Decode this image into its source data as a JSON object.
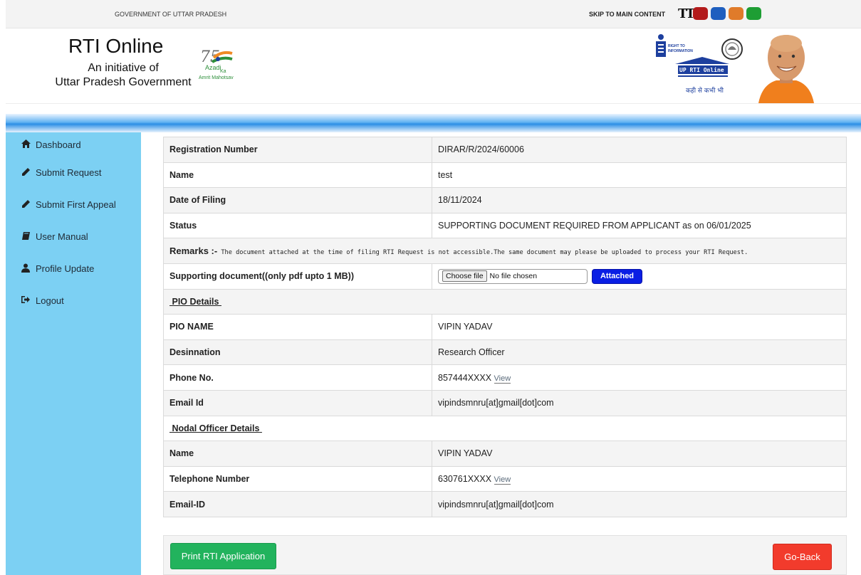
{
  "topbar": {
    "gov_label": "GOVERNMENT OF UTTAR PRADESH",
    "skip_link": "SKIP TO MAIN CONTENT",
    "text_size_icon": "TT",
    "theme_colors": [
      "#b22222",
      "#1f5fbf",
      "#e07b2a",
      "#1e9e34"
    ]
  },
  "header": {
    "title": "RTI Online",
    "subtitle_line1": "An initiative of",
    "subtitle_line2": "Uttar Pradesh Government",
    "azadi_logo": {
      "number": "75",
      "line1": "Azadi",
      "line2": "Ka",
      "line3": "Amrit Mahotsav"
    },
    "rti_logo": {
      "line1": "RIGHT TO",
      "line2": "INFORMATION",
      "badge": "UP RTI Online",
      "tagline": "कही से कभी भी"
    }
  },
  "sidebar": {
    "items": [
      {
        "label": "Dashboard",
        "icon": "home-icon"
      },
      {
        "label": "Submit Request",
        "icon": "pencil-icon"
      },
      {
        "label": "Submit First Appeal",
        "icon": "pencil-icon"
      },
      {
        "label": "User Manual",
        "icon": "book-icon"
      },
      {
        "label": "Profile Update",
        "icon": "user-icon"
      },
      {
        "label": "Logout",
        "icon": "sign-out-icon"
      }
    ]
  },
  "details": {
    "registration_label": "Registration Number",
    "registration_value": "DIRAR/R/2024/60006",
    "name_label": "Name",
    "name_value": "test",
    "date_label": "Date of Filing",
    "date_value": "18/11/2024",
    "status_label": "Status",
    "status_value": "SUPPORTING DOCUMENT REQUIRED FROM APPLICANT as on 06/01/2025",
    "remarks_label": "Remarks :-",
    "remarks_text": " The document attached at the time of filing RTI Request is not accessible.The same document may please be uploaded to process your RTI Request.",
    "supporting_label": "Supporting document((only pdf upto 1 MB))",
    "file_button": "Choose file",
    "file_status": "No file chosen",
    "attach_button": "Attached"
  },
  "pio": {
    "section_title": "PIO Details",
    "name_label": "PIO NAME",
    "name_value": "VIPIN YADAV",
    "designation_label": "Desinnation",
    "designation_value": "Research Officer",
    "phone_label": "Phone No.",
    "phone_value": "857444XXXX",
    "phone_view": "View",
    "email_label": "Email Id",
    "email_value": "vipindsmnru[at]gmail[dot]com"
  },
  "nodal": {
    "section_title": "Nodal Officer Details",
    "name_label": "Name",
    "name_value": "VIPIN YADAV",
    "phone_label": "Telephone Number",
    "phone_value": "630761XXXX",
    "phone_view": "View",
    "email_label": "Email-ID",
    "email_value": "vipindsmnru[at]gmail[dot]com"
  },
  "actions": {
    "print_label": "Print RTI Application",
    "back_label": "Go-Back"
  }
}
